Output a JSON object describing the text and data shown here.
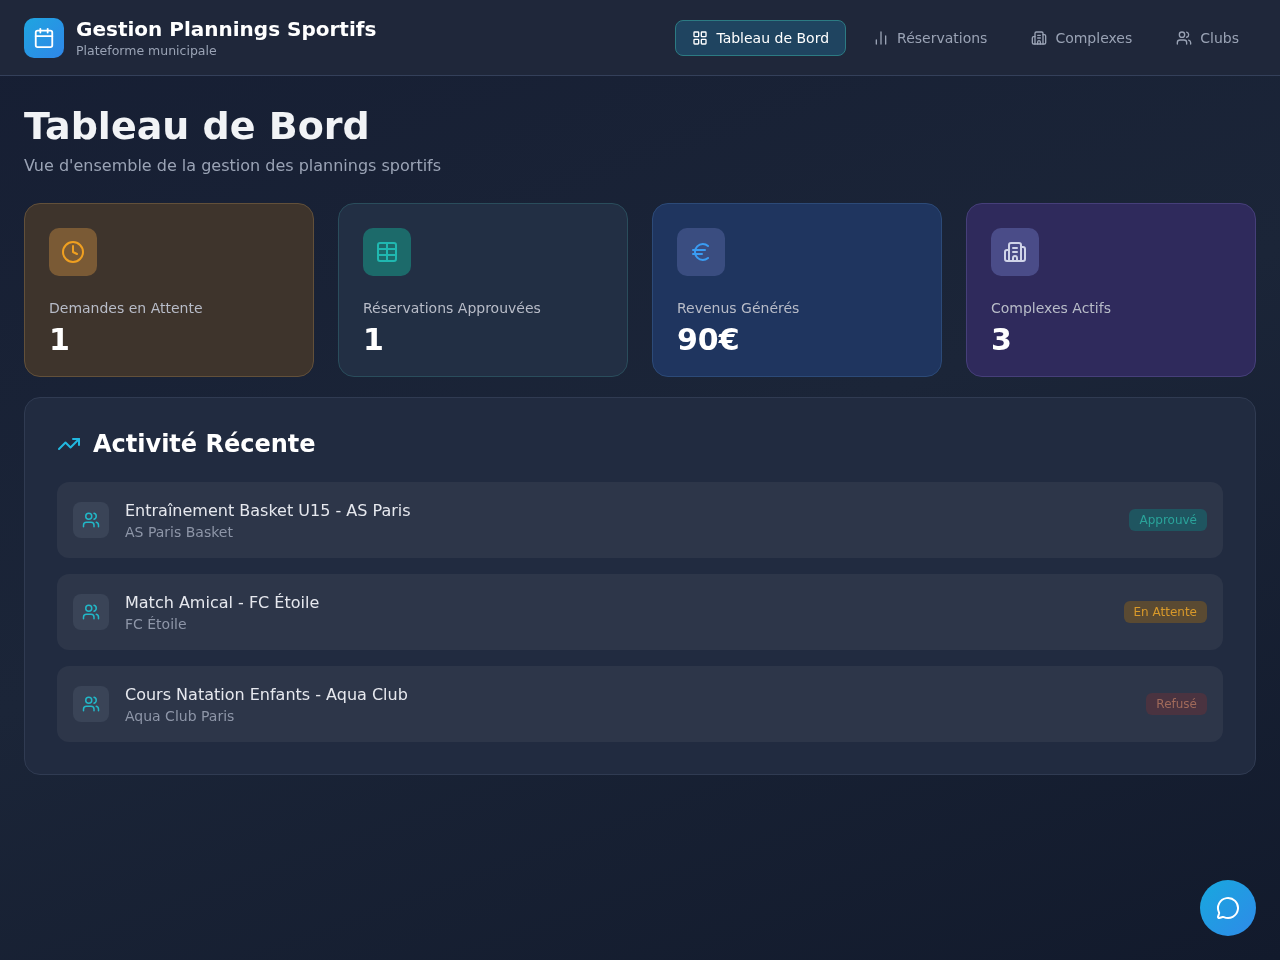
{
  "header": {
    "title": "Gestion Plannings Sportifs",
    "subtitle": "Plateforme municipale"
  },
  "nav": [
    {
      "label": "Tableau de Bord",
      "kind": "dashboard",
      "selected": true
    },
    {
      "label": "Réservations",
      "kind": "reservations",
      "selected": false
    },
    {
      "label": "Complexes",
      "kind": "complexes",
      "selected": false
    },
    {
      "label": "Clubs",
      "kind": "clubs",
      "selected": false
    }
  ],
  "page": {
    "title": "Tableau de Bord",
    "subtitle": "Vue d'ensemble de la gestion des plannings sportifs"
  },
  "stats": [
    {
      "label": "Demandes en Attente",
      "value": "1",
      "kind": "pending"
    },
    {
      "label": "Réservations Approuvées",
      "value": "1",
      "kind": "approved"
    },
    {
      "label": "Revenus Générés",
      "value": "90€",
      "kind": "revenue"
    },
    {
      "label": "Complexes Actifs",
      "value": "3",
      "kind": "complexes"
    }
  ],
  "activity": {
    "title": "Activité Récente",
    "items": [
      {
        "title": "Entraînement Basket U15 - AS Paris",
        "club": "AS Paris Basket",
        "status": "Approuvé",
        "kind": "approved"
      },
      {
        "title": "Match Amical - FC Étoile",
        "club": "FC Étoile",
        "status": "En Attente",
        "kind": "pending"
      },
      {
        "title": "Cours Natation Enfants - Aqua Club",
        "club": "Aqua Club Paris",
        "status": "Refusé",
        "kind": "refused"
      }
    ]
  }
}
